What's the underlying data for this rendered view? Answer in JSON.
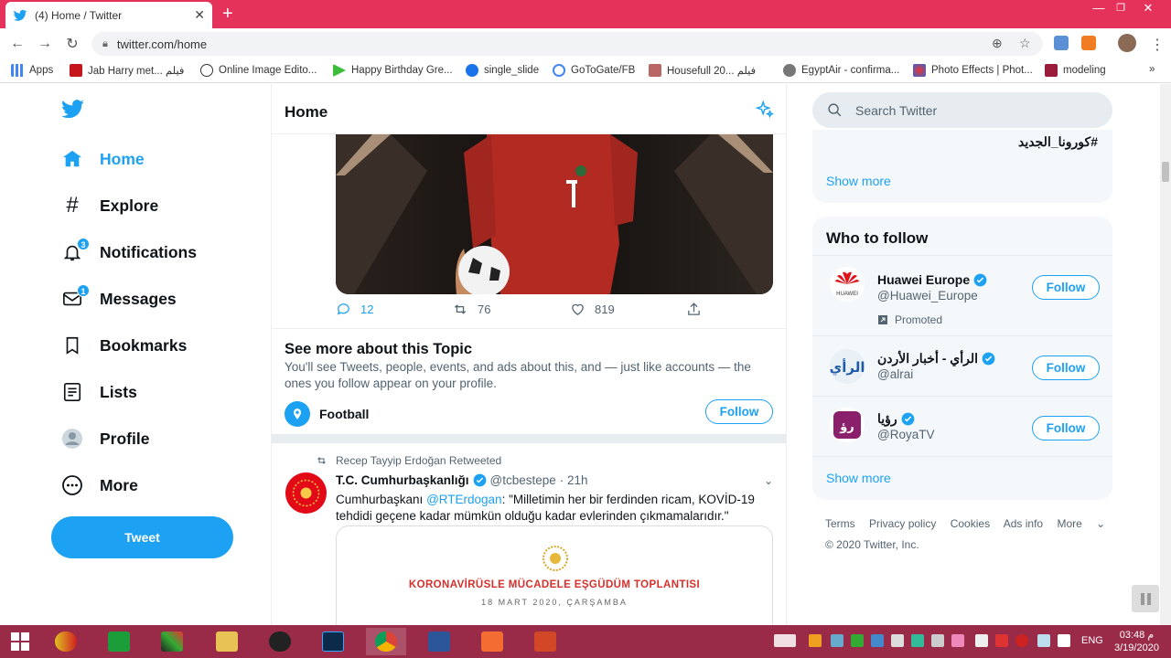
{
  "browser": {
    "tab_title": "(4) Home / Twitter",
    "url": "twitter.com/home",
    "bookmarks": [
      "Apps",
      "Jab Harry met... فيلم",
      "Online Image Edito...",
      "Happy Birthday Gre...",
      "single_slide",
      "GoToGate/FB",
      "Housefull 20... فيلم",
      "EgyptAir - confirma...",
      "Photo Effects | Phot...",
      "modeling"
    ]
  },
  "nav": {
    "home": "Home",
    "explore": "Explore",
    "notifications": "Notifications",
    "notifications_badge": "3",
    "messages": "Messages",
    "messages_badge": "1",
    "bookmarks": "Bookmarks",
    "lists": "Lists",
    "profile": "Profile",
    "more": "More",
    "tweet_button": "Tweet"
  },
  "main": {
    "title": "Home",
    "tweet1": {
      "replies": "12",
      "retweets": "76",
      "likes": "819"
    },
    "topic": {
      "heading": "See more about this Topic",
      "description": "You'll see Tweets, people, events, and ads about this, and — just like accounts — the ones you follow appear on your profile.",
      "name": "Football",
      "follow": "Follow"
    },
    "tweet2": {
      "retweeted_by": "Recep Tayyip Erdoğan Retweeted",
      "author": "T.C. Cumhurbaşkanlığı",
      "handle": "@tcbestepe",
      "time": "· 21h",
      "text_pre": "Cumhurbaşkanı ",
      "mention": "@RTErdogan",
      "text_post": ": \"Milletimin her bir ferdinden ricam, KOVİD-19 tehdidi geçene kadar mümkün olduğu kadar evlerinden çıkmamalarıdır.\"",
      "card_title_red": "KORONAVİRÜSLE MÜCADELE EŞGÜDÜM TOPLANTISI",
      "card_date": "18 MART 2020, ÇARŞAMBA"
    }
  },
  "right": {
    "search_placeholder": "Search Twitter",
    "trend_tag": "#كورونا_الجديد",
    "show_more_trends": "Show more",
    "who_to_follow": "Who to follow",
    "accounts": [
      {
        "name": "Huawei Europe",
        "handle": "@Huawei_Europe",
        "promoted": "Promoted",
        "follow": "Follow"
      },
      {
        "name": "الرأي - أخبار الأردن",
        "handle": "@alrai",
        "follow": "Follow"
      },
      {
        "name": "رؤيا",
        "handle": "@RoyaTV",
        "follow": "Follow"
      }
    ],
    "show_more_follow": "Show more",
    "footer_links": [
      "Terms",
      "Privacy policy",
      "Cookies",
      "Ads info",
      "More"
    ],
    "copyright": "© 2020 Twitter, Inc."
  },
  "taskbar": {
    "lang": "ENG",
    "time": "03:48 م",
    "date": "3/19/2020"
  },
  "colors": {
    "accent": "#1da1f2",
    "browser_bar": "#e4325b",
    "taskbar": "#9a2b48"
  }
}
